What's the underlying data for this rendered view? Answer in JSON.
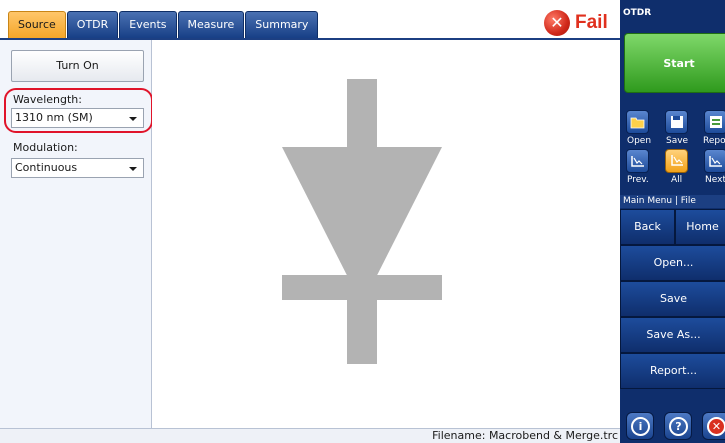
{
  "tabs": [
    {
      "label": "Source",
      "active": true
    },
    {
      "label": "OTDR",
      "active": false
    },
    {
      "label": "Events",
      "active": false
    },
    {
      "label": "Measure",
      "active": false
    },
    {
      "label": "Summary",
      "active": false
    }
  ],
  "status": {
    "label": "Fail",
    "color": "#e0301e"
  },
  "source_panel": {
    "turn_on_label": "Turn On",
    "wavelength_label": "Wavelength:",
    "wavelength_value": "1310 nm (SM)",
    "modulation_label": "Modulation:",
    "modulation_value": "Continuous"
  },
  "diagram": {
    "icon": "laser-diode-symbol",
    "color": "#b3b3b3"
  },
  "statusbar": {
    "filename": "Filename: Macrobend & Merge.trc"
  },
  "side_panel": {
    "title": "OTDR",
    "start_label": "Start",
    "open_label": "Open",
    "save_label": "Save",
    "report_label": "Repor",
    "prev_label": "Prev.",
    "all_label": "All",
    "next_label": "Next",
    "breadcrumb": "Main Menu | File",
    "back_label": "Back",
    "home_label": "Home",
    "menu_items": [
      "Open...",
      "Save",
      "Save As...",
      "Report..."
    ],
    "icons": [
      "info-icon",
      "help-icon",
      "close-icon"
    ]
  },
  "colors": {
    "tab_active": "#f4a629",
    "tab": "#173f86",
    "panel": "#0f2e6c",
    "start": "#2f9a1d",
    "highlight": "#e0142a"
  }
}
